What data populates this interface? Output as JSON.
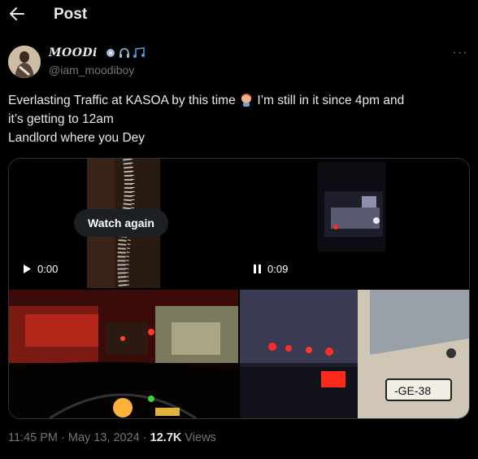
{
  "header": {
    "title": "Post"
  },
  "tweet": {
    "display_name": "MOODi",
    "handle": "@iam_moodiboy",
    "text_line1": "Everlasting Traffic at KASOA by this time",
    "text_line1b": "I’m still in it since 4pm and",
    "text_line2": "it’s getting to 12am",
    "text_line3": "Landlord where you Dey"
  },
  "media": {
    "video1": {
      "overlay_button": "Watch again",
      "time": "0:00"
    },
    "video2": {
      "time": "0:09"
    },
    "photo_plate_text": "GE"
  },
  "footer": {
    "time": "11:45 PM",
    "sep1": " · ",
    "date": "May 13, 2024",
    "sep2": " · ",
    "views_count": "12.7K",
    "views_label": " Views"
  },
  "colors": {
    "background": "#000000",
    "text": "#e7e9ea",
    "muted": "#71767b",
    "border": "#2f3336"
  }
}
